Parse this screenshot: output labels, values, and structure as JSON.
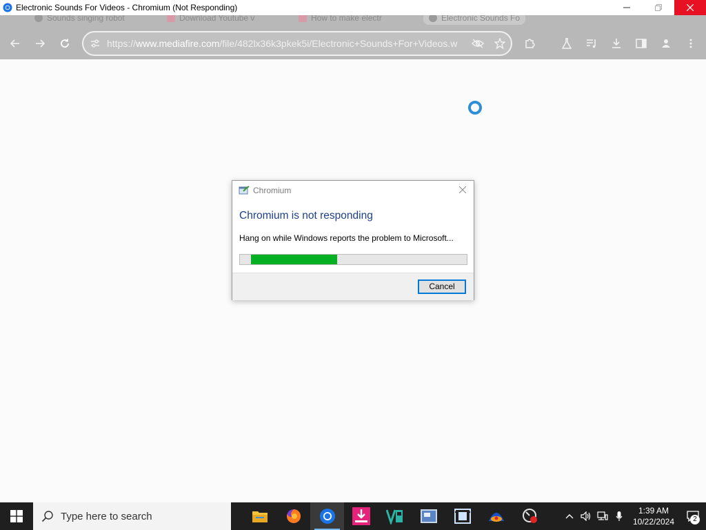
{
  "window": {
    "title": "Electronic Sounds For Videos - Chromium (Not Responding)",
    "minimize_icon": "minimize-icon",
    "restore_icon": "restore-icon",
    "close_icon": "close-icon"
  },
  "tabs": [
    {
      "label": "Sounds singing robot",
      "icon": "globe-icon"
    },
    {
      "label": "Download Youtube v",
      "icon": "page-icon"
    },
    {
      "label": "How to make electr",
      "icon": "page-icon"
    },
    {
      "label": "Electronic Sounds Fo",
      "icon": "globe-icon"
    }
  ],
  "toolbar": {
    "url_scheme": "https://",
    "url_host": "www.mediafire.com",
    "url_path": "/file/482lx36k3pkek5i/Electronic+Sounds+For+Videos.w",
    "icons": [
      "back-icon",
      "forward-icon",
      "reload-icon",
      "site-info-icon",
      "eye-off-icon",
      "star-icon",
      "extensions-icon",
      "labs-icon",
      "media-control-icon",
      "download-icon",
      "side-panel-icon",
      "profile-icon",
      "menu-icon"
    ]
  },
  "dialog": {
    "title": "Chromium",
    "heading": "Chromium is not responding",
    "message": "Hang on while Windows reports the problem to Microsoft...",
    "progress_percent": 40,
    "cancel_label": "Cancel"
  },
  "taskbar": {
    "search_placeholder": "Type here to search",
    "apps": [
      "file-explorer-icon",
      "firefox-icon",
      "chromium-icon",
      "download-app-icon",
      "vs-app-icon",
      "screen-tool-icon",
      "media-app-icon",
      "vpn-app-icon",
      "recorder-app-icon"
    ],
    "active_app": "chromium-icon",
    "time": "1:39 AM",
    "date": "10/22/2024",
    "notification_count": "2",
    "colors": {
      "taskbar_bg": "#1f1f1f",
      "accent": "#76b9ed"
    }
  },
  "colors": {
    "dialog_heading": "#1e3f8c",
    "progress_fill": "#06b025",
    "close_button": "#e81123",
    "spinner": "#2e8fd6"
  }
}
